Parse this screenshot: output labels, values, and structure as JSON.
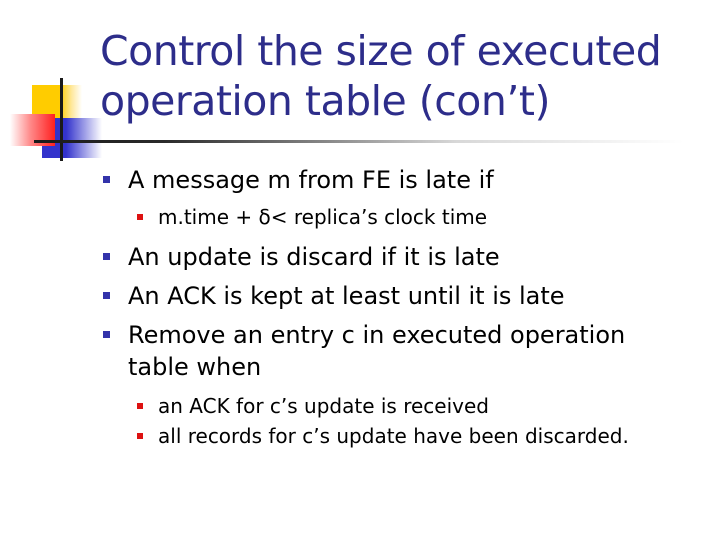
{
  "slide": {
    "title": "Control the size of executed operation table (con’t)",
    "colors": {
      "title": "#2d2d8a",
      "bullet_level1": "#3333aa",
      "bullet_level2": "#dd1111",
      "body_text": "#000000"
    },
    "bullets": [
      {
        "level": 1,
        "icon": "square-bullet-icon",
        "text": "A message m from FE is late if"
      },
      {
        "level": 2,
        "icon": "square-bullet-icon",
        "text": "m.time + δ< replica’s clock time"
      },
      {
        "level": 1,
        "icon": "square-bullet-icon",
        "text": "An update is discard if it is late"
      },
      {
        "level": 1,
        "icon": "square-bullet-icon",
        "text": "An ACK is kept at least until it is late"
      },
      {
        "level": 1,
        "icon": "square-bullet-icon",
        "text": "Remove an entry c in executed operation table when"
      },
      {
        "level": 2,
        "icon": "square-bullet-icon",
        "text": "an ACK for c’s update is received"
      },
      {
        "level": 2,
        "icon": "square-bullet-icon",
        "text": "all records for c’s update have been discarded."
      }
    ]
  }
}
